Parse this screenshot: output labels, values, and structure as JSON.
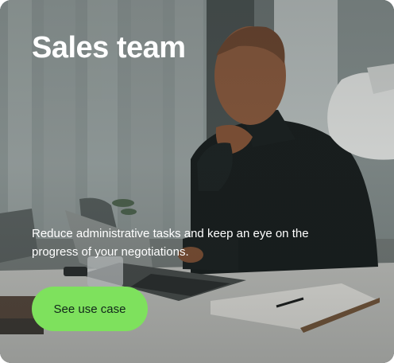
{
  "card": {
    "title": "Sales team",
    "description": "Reduce administrative tasks and keep an eye on the progress of your negotiations.",
    "cta_label": "See use case"
  },
  "colors": {
    "cta_background": "#7ee15d",
    "cta_text": "#11261a",
    "text": "#ffffff"
  }
}
